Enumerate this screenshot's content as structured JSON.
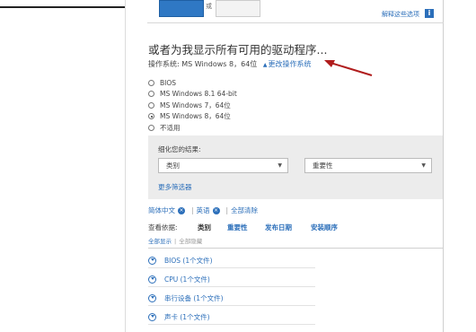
{
  "top": {
    "small_text": "或",
    "top_link": "解释这些选项",
    "info_icon": "i"
  },
  "heading": "或者为我显示所有可用的驱动程序...",
  "os": {
    "label": "操作系统: MS Windows 8，64位",
    "change_link": "更改操作系统",
    "change_link_icon": "▲"
  },
  "os_options": [
    {
      "label": "BIOS",
      "checked": false
    },
    {
      "label": "MS Windows 8.1 64-bit",
      "checked": false
    },
    {
      "label": "MS Windows 7，64位",
      "checked": false
    },
    {
      "label": "MS Windows 8，64位",
      "checked": true
    },
    {
      "label": "不适用",
      "checked": false
    }
  ],
  "filter": {
    "title": "细化您的结果:",
    "category_select": "类别",
    "importance_select": "重要性",
    "caret": "▼",
    "more_filters": "更多筛选器"
  },
  "chips": {
    "chip1": "简体中文",
    "chip2": "英语",
    "clear_all": "全部清除",
    "remove_icon": "×",
    "separator": "|"
  },
  "view": {
    "label": "查看依据:",
    "tabs": [
      "类别",
      "重要性",
      "发布日期",
      "安装顺序"
    ],
    "show_all": "全部显示",
    "hide_all": "全部隐藏",
    "separator": "|"
  },
  "categories": [
    "BIOS (1个文件)",
    "CPU (1个文件)",
    "串行设备 (1个文件)",
    "声卡 (1个文件)"
  ],
  "colors": {
    "link": "#2c6fba",
    "panel_bg": "#ececec",
    "annotation_arrow": "#b01c1c"
  }
}
